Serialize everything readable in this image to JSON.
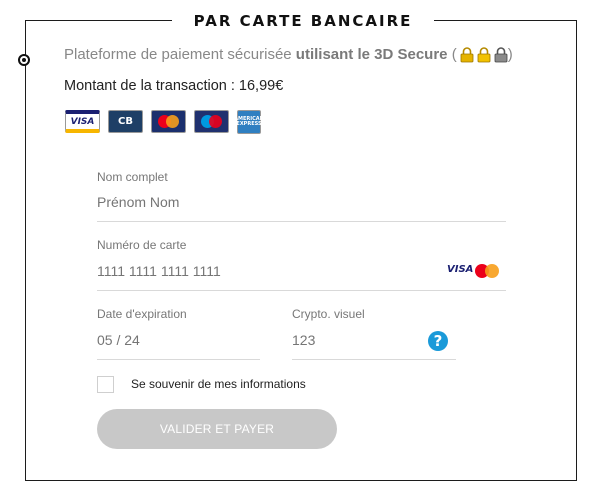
{
  "section_title": "PAR CARTE BANCAIRE",
  "secure": {
    "text_prefix": "Plateforme de paiement sécurisée",
    "text_bold": "utilisant le 3D Secure",
    "paren_open": "(",
    "paren_close": ")"
  },
  "amount_text": "Montant de la transaction : 16,99€",
  "card_logos": {
    "visa": "VISA",
    "cb": "CB",
    "amex": "AMERICAN EXPRESS"
  },
  "form": {
    "name": {
      "label": "Nom complet",
      "placeholder": "Prénom Nom"
    },
    "card_number": {
      "label": "Numéro de carte",
      "placeholder": "1111 1111 1111 1111",
      "brand": "VISA"
    },
    "expiry": {
      "label": "Date d'expiration",
      "placeholder": "05 / 24"
    },
    "cvv": {
      "label": "Crypto. visuel",
      "placeholder": "123",
      "help": "?"
    },
    "remember_label": "Se souvenir de mes informations",
    "submit_label": "VALIDER ET PAYER"
  },
  "colors": {
    "help": "#1a9ad9",
    "submit_disabled": "#c8c8c8",
    "lock": "#e5b300"
  }
}
